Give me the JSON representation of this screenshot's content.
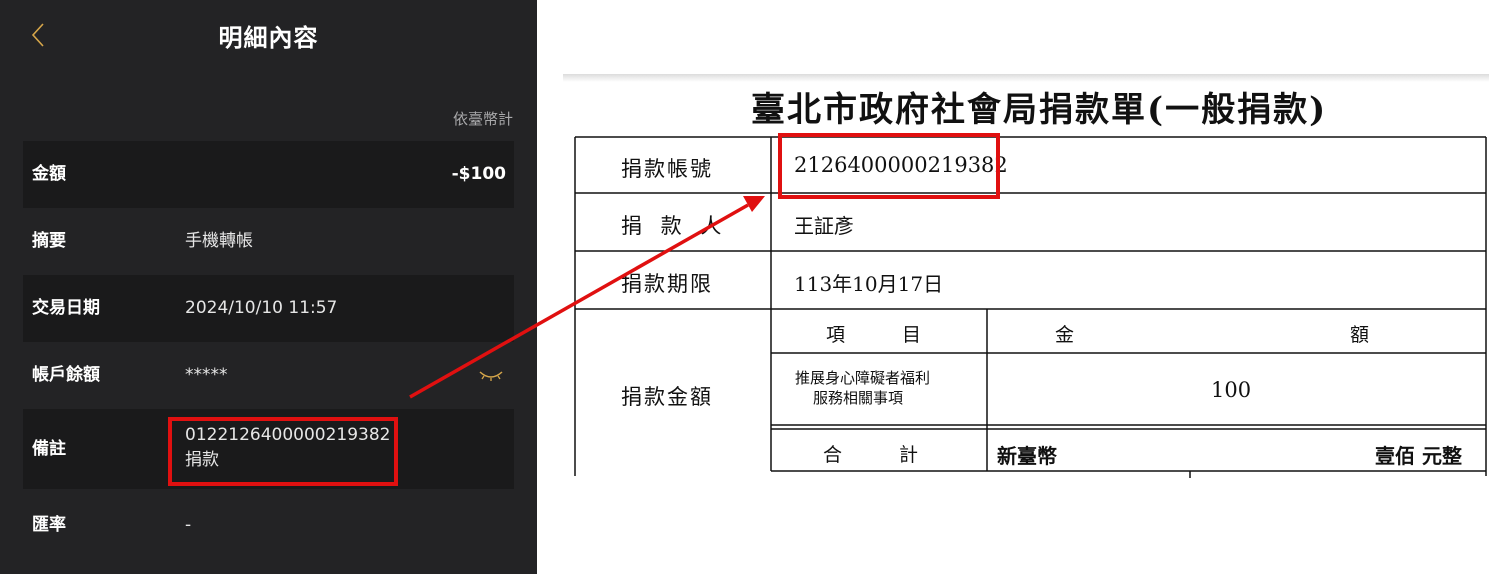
{
  "phone": {
    "title": "明細內容",
    "currency_note": "依臺幣計",
    "rows": [
      {
        "label": "金額",
        "value": "-$100"
      },
      {
        "label": "摘要",
        "value": "手機轉帳"
      },
      {
        "label": "交易日期",
        "value": "2024/10/10 11:57"
      },
      {
        "label": "帳戶餘額",
        "value": "*****"
      },
      {
        "label": "備註",
        "value_line1": "0122126400000219382",
        "value_line2": "捐款"
      },
      {
        "label": "匯率",
        "value": "-"
      }
    ]
  },
  "document": {
    "title": "臺北市政府社會局捐款單(一般捐款)",
    "account_label": "捐款帳號",
    "account_value": "2126400000219382",
    "donor_label": "捐 款 人",
    "donor_value": "王証彥",
    "deadline_label": "捐款期限",
    "deadline_value": "113年10月17日",
    "amount_label": "捐款金額",
    "item_header": "項　　　目",
    "amount_header_left": "金",
    "amount_header_right": "額",
    "item_line1": "推展身心障礙者福利",
    "item_line2": "服務相關事項",
    "item_amount": "100",
    "total_label": "合　　　計",
    "total_currency": "新臺幣",
    "total_words": "壹佰 元整"
  },
  "colors": {
    "highlight": "#e01010",
    "phone_bg": "#232325",
    "accent_gold": "#d6a64a"
  }
}
